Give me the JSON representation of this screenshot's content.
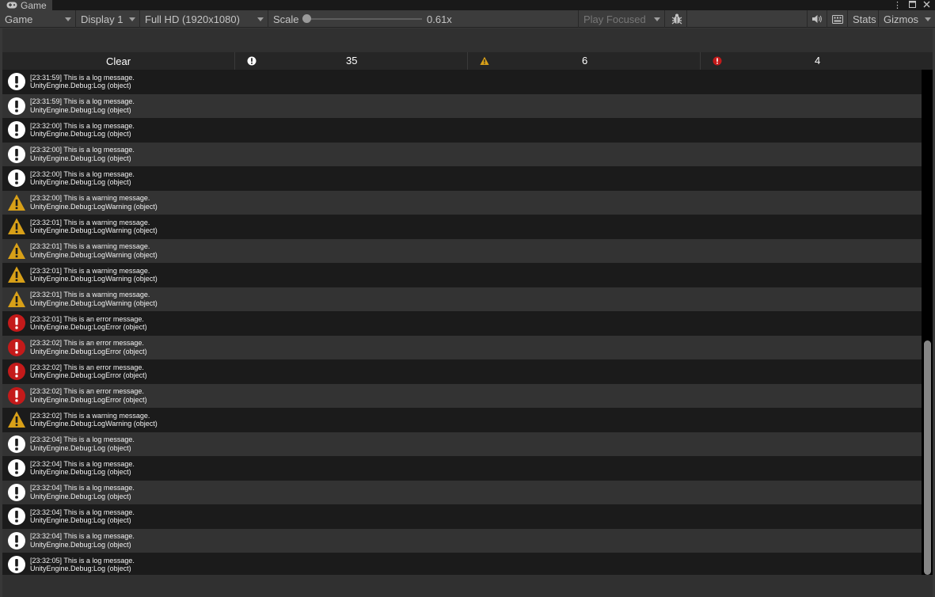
{
  "window": {
    "tab_title": "Game",
    "tab_icon": "gamepad-icon",
    "menu_icon": "kebab-menu-icon",
    "maximize_icon": "maximize-icon",
    "close_icon": "close-icon"
  },
  "toolbar": {
    "view_mode": "Game",
    "display": "Display 1",
    "resolution": "Full HD (1920x1080)",
    "scale_label": "Scale",
    "scale_value": "0.61x",
    "scale_level": 0.0,
    "play_mode": "Play Focused",
    "stats_label": "Stats",
    "gizmos_label": "Gizmos"
  },
  "console": {
    "clear_label": "Clear",
    "log_count": "35",
    "warning_count": "6",
    "error_count": "4"
  },
  "colors": {
    "log": "#ffffff",
    "warning": "#d8a018",
    "error": "#c41a1a"
  },
  "logs": [
    {
      "type": "log",
      "message": "[23:31:59] This is a log message.",
      "trace": "UnityEngine.Debug:Log (object)"
    },
    {
      "type": "log",
      "message": "[23:31:59] This is a log message.",
      "trace": "UnityEngine.Debug:Log (object)"
    },
    {
      "type": "log",
      "message": "[23:32:00] This is a log message.",
      "trace": "UnityEngine.Debug:Log (object)"
    },
    {
      "type": "log",
      "message": "[23:32:00] This is a log message.",
      "trace": "UnityEngine.Debug:Log (object)"
    },
    {
      "type": "log",
      "message": "[23:32:00] This is a log message.",
      "trace": "UnityEngine.Debug:Log (object)"
    },
    {
      "type": "warning",
      "message": "[23:32:00] This is a warning message.",
      "trace": "UnityEngine.Debug:LogWarning (object)"
    },
    {
      "type": "warning",
      "message": "[23:32:01] This is a warning message.",
      "trace": "UnityEngine.Debug:LogWarning (object)"
    },
    {
      "type": "warning",
      "message": "[23:32:01] This is a warning message.",
      "trace": "UnityEngine.Debug:LogWarning (object)"
    },
    {
      "type": "warning",
      "message": "[23:32:01] This is a warning message.",
      "trace": "UnityEngine.Debug:LogWarning (object)"
    },
    {
      "type": "warning",
      "message": "[23:32:01] This is a warning message.",
      "trace": "UnityEngine.Debug:LogWarning (object)"
    },
    {
      "type": "error",
      "message": "[23:32:01] This is an error message.",
      "trace": "UnityEngine.Debug:LogError (object)"
    },
    {
      "type": "error",
      "message": "[23:32:02] This is an error message.",
      "trace": "UnityEngine.Debug:LogError (object)"
    },
    {
      "type": "error",
      "message": "[23:32:02] This is an error message.",
      "trace": "UnityEngine.Debug:LogError (object)"
    },
    {
      "type": "error",
      "message": "[23:32:02] This is an error message.",
      "trace": "UnityEngine.Debug:LogError (object)"
    },
    {
      "type": "warning",
      "message": "[23:32:02] This is a warning message.",
      "trace": "UnityEngine.Debug:LogWarning (object)"
    },
    {
      "type": "log",
      "message": "[23:32:04] This is a log message.",
      "trace": "UnityEngine.Debug:Log (object)"
    },
    {
      "type": "log",
      "message": "[23:32:04] This is a log message.",
      "trace": "UnityEngine.Debug:Log (object)"
    },
    {
      "type": "log",
      "message": "[23:32:04] This is a log message.",
      "trace": "UnityEngine.Debug:Log (object)"
    },
    {
      "type": "log",
      "message": "[23:32:04] This is a log message.",
      "trace": "UnityEngine.Debug:Log (object)"
    },
    {
      "type": "log",
      "message": "[23:32:04] This is a log message.",
      "trace": "UnityEngine.Debug:Log (object)"
    },
    {
      "type": "log",
      "message": "[23:32:05] This is a log message.",
      "trace": "UnityEngine.Debug:Log (object)"
    }
  ]
}
